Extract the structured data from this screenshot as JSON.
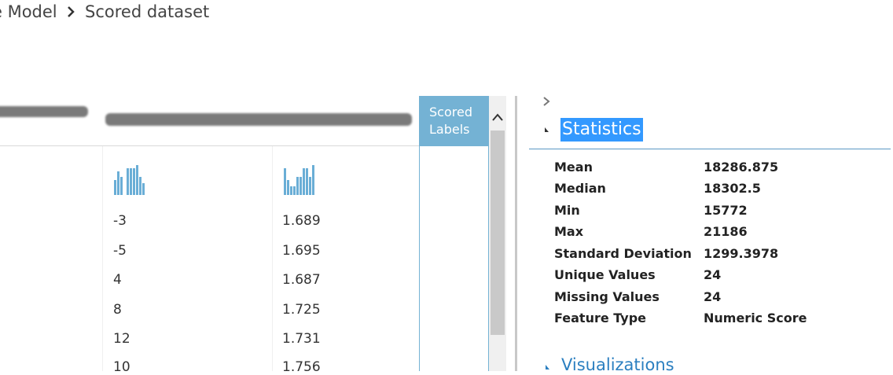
{
  "breadcrumb": {
    "parent": "e Model",
    "current": "Scored dataset"
  },
  "table": {
    "scored_header_line1": "Scored",
    "scored_header_line2": "Labels",
    "columns": [
      {
        "values": [
          "-3",
          "-5",
          "4",
          "8",
          "12",
          "10"
        ]
      },
      {
        "values": [
          "1.689",
          "1.695",
          "1.687",
          "1.725",
          "1.731",
          "1.756"
        ]
      }
    ],
    "sparklines": [
      [
        0.5,
        0.8,
        0.6,
        0,
        0.9,
        0.9,
        0.9,
        1.0,
        0.6,
        0.4
      ],
      [
        0.9,
        0.5,
        0.3,
        0.3,
        0.6,
        0.6,
        0.9,
        0.9,
        0.6,
        1.0
      ]
    ]
  },
  "statistics": {
    "title": "Statistics",
    "rows": [
      {
        "label": "Mean",
        "value": "18286.875"
      },
      {
        "label": "Median",
        "value": "18302.5"
      },
      {
        "label": "Min",
        "value": "15772"
      },
      {
        "label": "Max",
        "value": "21186"
      },
      {
        "label": "Standard Deviation",
        "value": "1299.3978"
      },
      {
        "label": "Unique Values",
        "value": "24"
      },
      {
        "label": "Missing Values",
        "value": "24"
      },
      {
        "label": "Feature Type",
        "value": "Numeric Score"
      }
    ]
  },
  "visualizations": {
    "title": "Visualizations"
  },
  "colors": {
    "accent": "#74b2d4",
    "selection": "#3399ff",
    "link": "#2b7fc0"
  }
}
